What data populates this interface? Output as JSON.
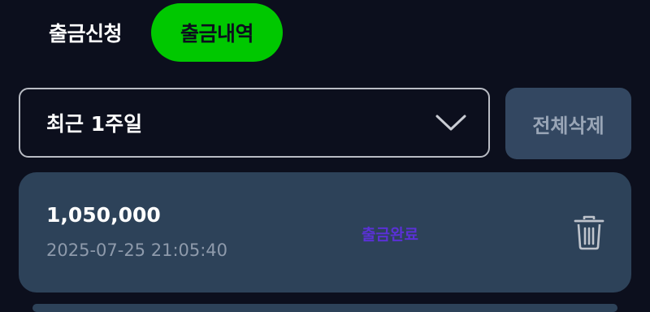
{
  "tabs": {
    "request_label": "출금신청",
    "history_label": "출금내역",
    "active": "history"
  },
  "filter": {
    "period_value": "최근 1주일",
    "delete_all_label": "전체삭제"
  },
  "records": [
    {
      "amount": "1,050,000",
      "datetime": "2025-07-25 21:05:40",
      "status": "출금완료"
    }
  ],
  "icons": {
    "dropdown": "chevron-down-icon",
    "delete": "trash-icon"
  },
  "colors": {
    "background": "#0c0f1d",
    "active_tab": "#00c800",
    "card": "#2d4259",
    "button": "#334761",
    "status_text": "#5a31d6"
  }
}
